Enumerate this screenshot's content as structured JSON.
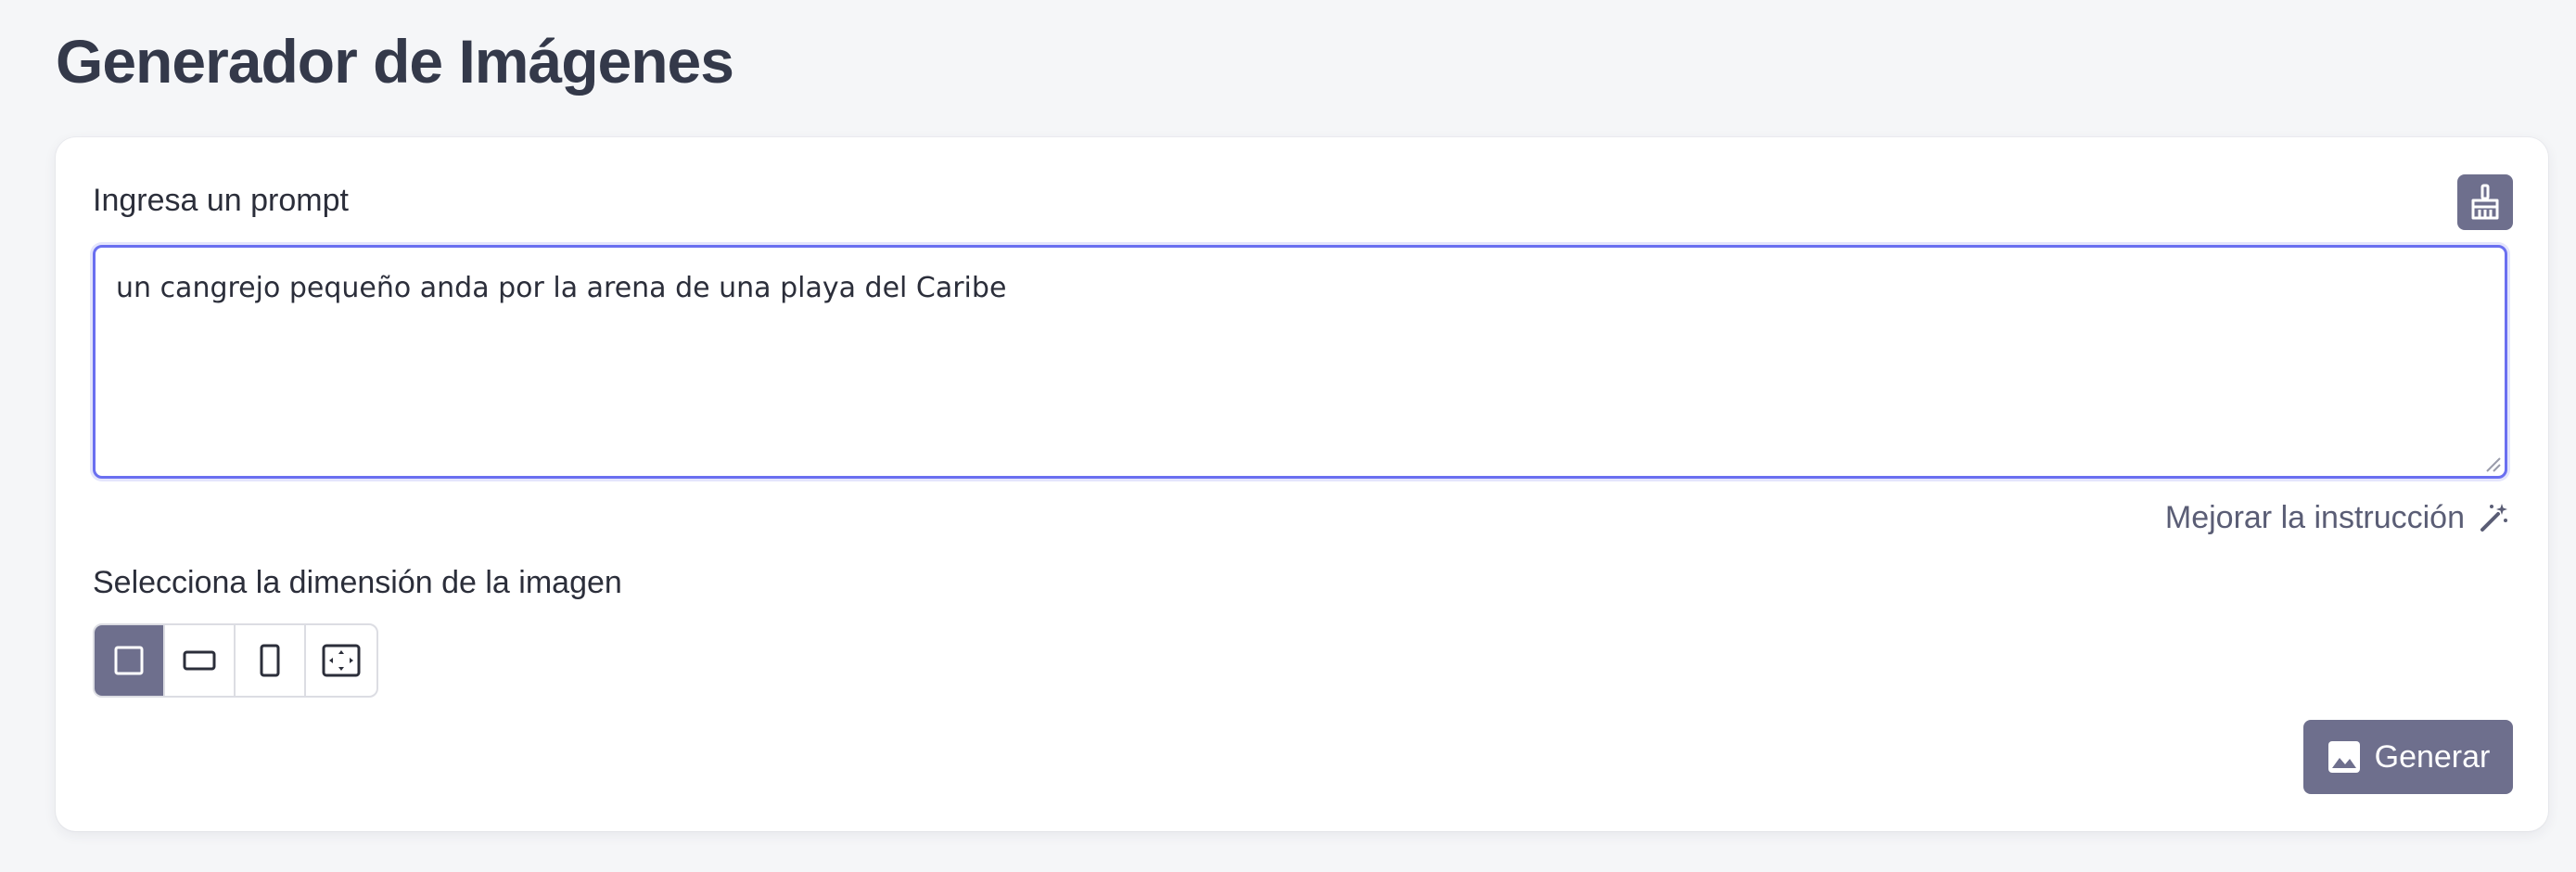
{
  "page": {
    "title": "Generador de Imágenes"
  },
  "prompt": {
    "label": "Ingresa un prompt",
    "value": "un cangrejo pequeño anda por la arena de una playa del Caribe",
    "clear_icon": "broom-icon"
  },
  "improve": {
    "label": "Mejorar la instrucción",
    "icon": "magic-wand-icon"
  },
  "dimension": {
    "label": "Selecciona la dimensión de la imagen",
    "options": [
      {
        "name": "square",
        "icon": "square-icon",
        "selected": true
      },
      {
        "name": "landscape",
        "icon": "landscape-rect-icon",
        "selected": false
      },
      {
        "name": "portrait",
        "icon": "portrait-rect-icon",
        "selected": false
      },
      {
        "name": "custom",
        "icon": "expand-frame-icon",
        "selected": false
      }
    ]
  },
  "generate": {
    "label": "Generar",
    "icon": "image-icon"
  },
  "colors": {
    "accent": "#6e6f8d",
    "focus_border": "#6a6ff0",
    "background": "#f5f6f8"
  }
}
